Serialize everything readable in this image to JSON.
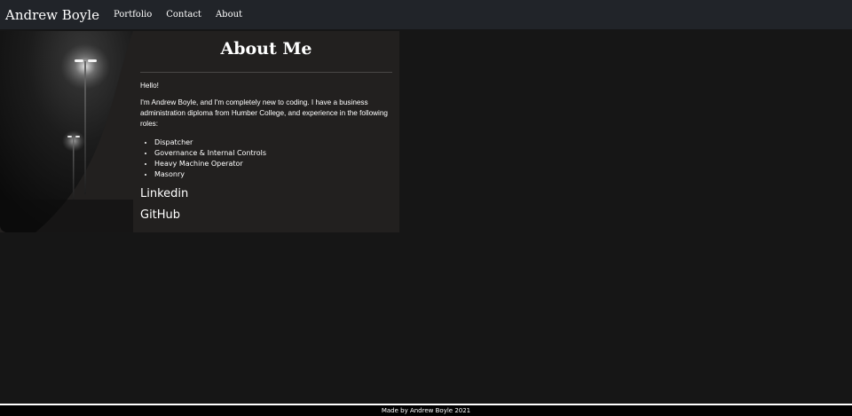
{
  "nav": {
    "brand": "Andrew Boyle",
    "links": [
      "Portfolio",
      "Contact",
      "About"
    ]
  },
  "about": {
    "title": "About Me",
    "greeting": "Hello!",
    "intro": "I'm Andrew Boyle, and I'm completely new to coding. I have a business administration diploma from Humber College, and experience in the following roles:",
    "roles": [
      "Dispatcher",
      "Governance & Internal Controls",
      "Heavy Machine Operator",
      "Masonry"
    ],
    "links": {
      "linkedin": "Linkedin",
      "github": "GitHub"
    }
  },
  "footer": {
    "text": "Made by Andrew Boyle 2021"
  },
  "colors": {
    "navbar_bg": "#212429",
    "page_bg": "#161616",
    "card_bg": "#22201f",
    "text": "#ffffff"
  }
}
